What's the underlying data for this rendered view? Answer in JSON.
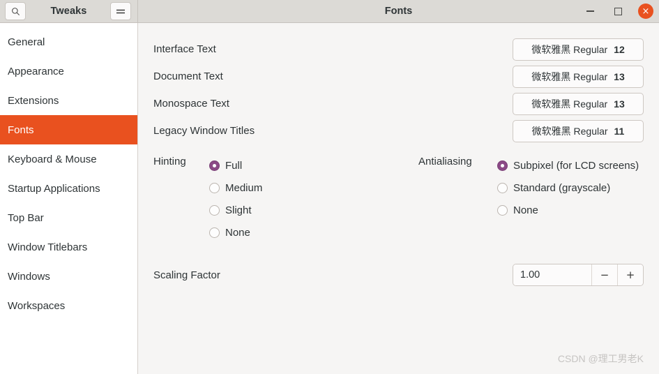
{
  "header": {
    "app_title": "Tweaks",
    "window_title": "Fonts",
    "search_icon": "search-icon",
    "menu_icon": "hamburger-menu-icon",
    "minimize_label": "",
    "maximize_label": "",
    "close_label": "×",
    "close_color": "#e9511f"
  },
  "sidebar": {
    "active": "Fonts",
    "accent_color": "#e9511f",
    "items": [
      {
        "label": "General"
      },
      {
        "label": "Appearance"
      },
      {
        "label": "Extensions"
      },
      {
        "label": "Fonts"
      },
      {
        "label": "Keyboard & Mouse"
      },
      {
        "label": "Startup Applications"
      },
      {
        "label": "Top Bar"
      },
      {
        "label": "Window Titlebars"
      },
      {
        "label": "Windows"
      },
      {
        "label": "Workspaces"
      }
    ]
  },
  "main": {
    "font_rows": [
      {
        "label": "Interface Text",
        "font_name": "微软雅黑 Regular",
        "size": "12"
      },
      {
        "label": "Document Text",
        "font_name": "微软雅黑 Regular",
        "size": "13"
      },
      {
        "label": "Monospace Text",
        "font_name": "微软雅黑 Regular",
        "size": "13"
      },
      {
        "label": "Legacy Window Titles",
        "font_name": "微软雅黑 Regular",
        "size": "11"
      }
    ],
    "hinting": {
      "label": "Hinting",
      "selected": "Full",
      "options": [
        {
          "label": "Full"
        },
        {
          "label": "Medium"
        },
        {
          "label": "Slight"
        },
        {
          "label": "None"
        }
      ]
    },
    "antialiasing": {
      "label": "Antialiasing",
      "selected": "Subpixel (for LCD screens)",
      "radio_color": "#8b4a86",
      "options": [
        {
          "label": "Subpixel (for LCD screens)"
        },
        {
          "label": "Standard (grayscale)"
        },
        {
          "label": "None"
        }
      ]
    },
    "scaling": {
      "label": "Scaling Factor",
      "value": "1.00",
      "decrement_label": "−",
      "increment_label": "+"
    }
  },
  "watermark": {
    "text": "CSDN @理工男老K"
  }
}
